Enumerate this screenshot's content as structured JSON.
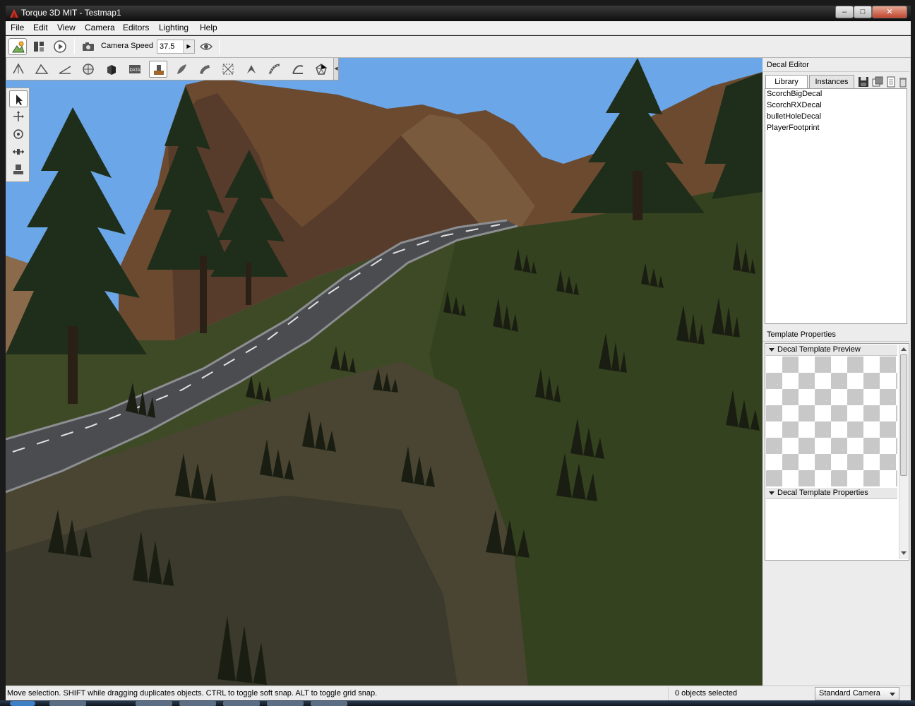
{
  "window": {
    "title": "Torque 3D MIT - Testmap1",
    "controls": {
      "minimize": "–",
      "maximize": "□",
      "close": "✕"
    }
  },
  "menu": [
    "File",
    "Edit",
    "View",
    "Camera",
    "Editors",
    "Lighting",
    "Help"
  ],
  "toolbar": {
    "buttons": [
      "world-editor-icon",
      "gui-editor-icon",
      "play-icon",
      "camera-icon",
      "visibility-icon"
    ],
    "camera_speed_label": "Camera Speed",
    "camera_speed_value": "37.5",
    "camera_speed_arrow": "▶"
  },
  "editor_tools": {
    "items": [
      "object-editor-icon",
      "terrain-editor-icon",
      "terrain-painter-icon",
      "material-editor-icon",
      "sketch-tool-icon",
      "datablock-editor-icon",
      "decal-editor-icon",
      "forest-editor-icon",
      "river-editor-icon",
      "mesh-road-editor-icon",
      "particle-editor-icon",
      "road-editor-icon",
      "shape-editor-icon",
      "navmesh-editor-icon"
    ],
    "datablock_label": "DATA",
    "active_index": 6,
    "grip": "◀"
  },
  "gizmo": {
    "items": [
      "select-arrow-icon",
      "move-icon",
      "rotate-icon",
      "scale-icon",
      "drop-icon"
    ],
    "active_index": 0
  },
  "decal_editor": {
    "title": "Decal Editor",
    "tabs": [
      "Library",
      "Instances"
    ],
    "active_tab": "Library",
    "actions": [
      "save-icon",
      "copy-icon",
      "new-icon",
      "delete-icon"
    ],
    "library_items": [
      "ScorchBigDecal",
      "ScorchRXDecal",
      "bulletHoleDecal",
      "PlayerFootprint"
    ]
  },
  "template_properties": {
    "title": "Template Properties",
    "preview_section": "Decal Template Preview",
    "properties_section": "Decal Template Properties"
  },
  "status": {
    "message": "Move selection.  SHIFT while dragging duplicates objects.  CTRL to toggle soft snap.  ALT to toggle grid snap.",
    "selection_count": "0 objects selected",
    "camera_mode": "Standard Camera"
  },
  "colors": {
    "sky": "#6aa6e8",
    "grass": "#3e4a26",
    "rock": "#6b4a30",
    "road": "#4a4c50",
    "tree": "#1f2e1a",
    "accent": "#c0392b"
  }
}
